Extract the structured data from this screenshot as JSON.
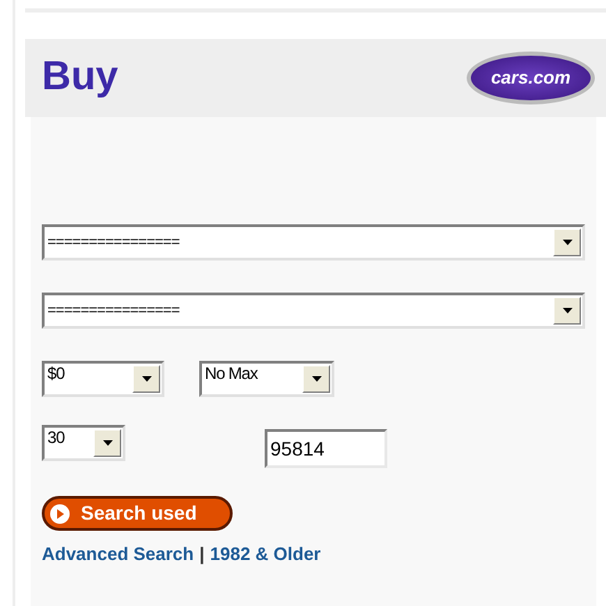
{
  "header": {
    "title": "Buy",
    "logo_text": "cars.com"
  },
  "selects": [
    {
      "value": "================"
    },
    {
      "value": "================"
    }
  ],
  "price": [
    {
      "value": "$0"
    },
    {
      "value": "No Max"
    }
  ],
  "distance": {
    "value": "30"
  },
  "zip": {
    "value": "95814"
  },
  "search_button": {
    "label": "Search used"
  },
  "links": [
    {
      "label": "Advanced Search"
    },
    {
      "label": "1982 & Older"
    }
  ],
  "separator": "|"
}
